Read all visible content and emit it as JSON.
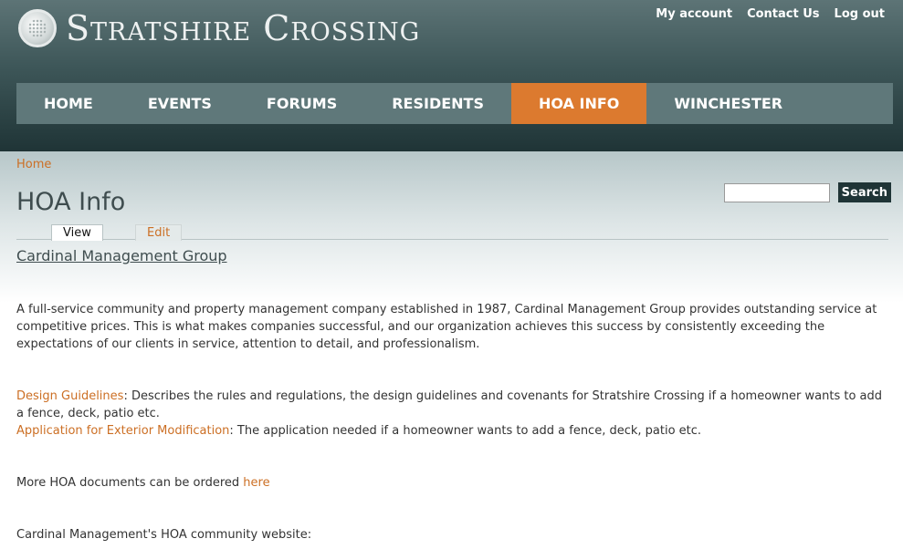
{
  "site": {
    "name": "Stratshire Crossing"
  },
  "secondary_links": [
    "My account",
    "Contact Us",
    "Log out"
  ],
  "nav": {
    "items": [
      "HOME",
      "EVENTS",
      "FORUMS",
      "RESIDENTS",
      "HOA INFO",
      "WINCHESTER"
    ],
    "active_index": 4
  },
  "breadcrumb": "Home",
  "page": {
    "title": "HOA Info"
  },
  "search": {
    "button_label": "Search",
    "value": ""
  },
  "tabs": {
    "view": "View",
    "edit": "Edit"
  },
  "content": {
    "org_link": "Cardinal Management Group",
    "intro": "A full-service community and property management company established in 1987, Cardinal Management Group provides outstanding service at competitive prices. This is what makes companies successful, and our organization achieves this success by consistently exceeding the expectations of our clients in service, attention to detail, and professionalism.",
    "doc1_link": "Design Guidelines",
    "doc1_text": ": Describes the rules and regulations, the design guidelines and covenants for Stratshire Crossing if a homeowner wants to add a fence, deck, patio etc.",
    "doc2_link": "Application for Exterior Modification",
    "doc2_text": ": The application needed if a homeowner wants to add a fence, deck, patio etc.",
    "more_text": "More HOA documents can be ordered ",
    "more_link": "here",
    "website_text": "Cardinal Management's HOA community website:"
  },
  "colors": {
    "accent": "#dc7a2f",
    "header_dark": "#1f3436",
    "link": "#cc6f24"
  }
}
